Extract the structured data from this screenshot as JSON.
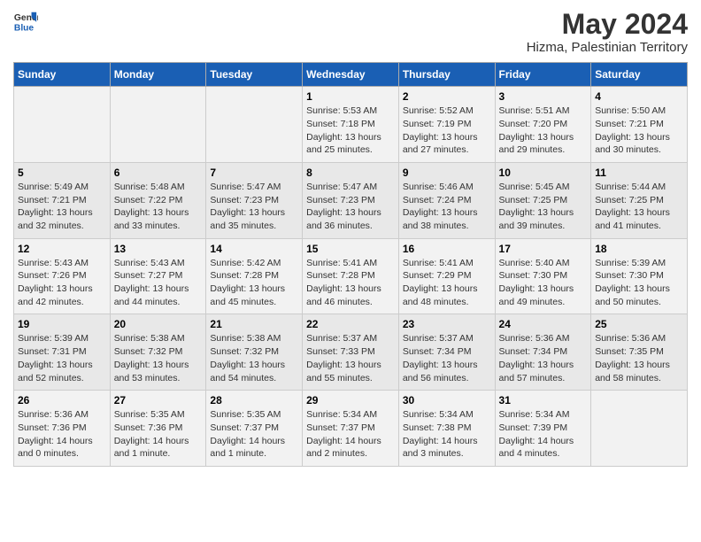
{
  "logo": {
    "line1": "General",
    "line2": "Blue"
  },
  "title": "May 2024",
  "subtitle": "Hizma, Palestinian Territory",
  "days_of_week": [
    "Sunday",
    "Monday",
    "Tuesday",
    "Wednesday",
    "Thursday",
    "Friday",
    "Saturday"
  ],
  "weeks": [
    [
      {
        "day": "",
        "info": ""
      },
      {
        "day": "",
        "info": ""
      },
      {
        "day": "",
        "info": ""
      },
      {
        "day": "1",
        "info": "Sunrise: 5:53 AM\nSunset: 7:18 PM\nDaylight: 13 hours\nand 25 minutes."
      },
      {
        "day": "2",
        "info": "Sunrise: 5:52 AM\nSunset: 7:19 PM\nDaylight: 13 hours\nand 27 minutes."
      },
      {
        "day": "3",
        "info": "Sunrise: 5:51 AM\nSunset: 7:20 PM\nDaylight: 13 hours\nand 29 minutes."
      },
      {
        "day": "4",
        "info": "Sunrise: 5:50 AM\nSunset: 7:21 PM\nDaylight: 13 hours\nand 30 minutes."
      }
    ],
    [
      {
        "day": "5",
        "info": "Sunrise: 5:49 AM\nSunset: 7:21 PM\nDaylight: 13 hours\nand 32 minutes."
      },
      {
        "day": "6",
        "info": "Sunrise: 5:48 AM\nSunset: 7:22 PM\nDaylight: 13 hours\nand 33 minutes."
      },
      {
        "day": "7",
        "info": "Sunrise: 5:47 AM\nSunset: 7:23 PM\nDaylight: 13 hours\nand 35 minutes."
      },
      {
        "day": "8",
        "info": "Sunrise: 5:47 AM\nSunset: 7:23 PM\nDaylight: 13 hours\nand 36 minutes."
      },
      {
        "day": "9",
        "info": "Sunrise: 5:46 AM\nSunset: 7:24 PM\nDaylight: 13 hours\nand 38 minutes."
      },
      {
        "day": "10",
        "info": "Sunrise: 5:45 AM\nSunset: 7:25 PM\nDaylight: 13 hours\nand 39 minutes."
      },
      {
        "day": "11",
        "info": "Sunrise: 5:44 AM\nSunset: 7:25 PM\nDaylight: 13 hours\nand 41 minutes."
      }
    ],
    [
      {
        "day": "12",
        "info": "Sunrise: 5:43 AM\nSunset: 7:26 PM\nDaylight: 13 hours\nand 42 minutes."
      },
      {
        "day": "13",
        "info": "Sunrise: 5:43 AM\nSunset: 7:27 PM\nDaylight: 13 hours\nand 44 minutes."
      },
      {
        "day": "14",
        "info": "Sunrise: 5:42 AM\nSunset: 7:28 PM\nDaylight: 13 hours\nand 45 minutes."
      },
      {
        "day": "15",
        "info": "Sunrise: 5:41 AM\nSunset: 7:28 PM\nDaylight: 13 hours\nand 46 minutes."
      },
      {
        "day": "16",
        "info": "Sunrise: 5:41 AM\nSunset: 7:29 PM\nDaylight: 13 hours\nand 48 minutes."
      },
      {
        "day": "17",
        "info": "Sunrise: 5:40 AM\nSunset: 7:30 PM\nDaylight: 13 hours\nand 49 minutes."
      },
      {
        "day": "18",
        "info": "Sunrise: 5:39 AM\nSunset: 7:30 PM\nDaylight: 13 hours\nand 50 minutes."
      }
    ],
    [
      {
        "day": "19",
        "info": "Sunrise: 5:39 AM\nSunset: 7:31 PM\nDaylight: 13 hours\nand 52 minutes."
      },
      {
        "day": "20",
        "info": "Sunrise: 5:38 AM\nSunset: 7:32 PM\nDaylight: 13 hours\nand 53 minutes."
      },
      {
        "day": "21",
        "info": "Sunrise: 5:38 AM\nSunset: 7:32 PM\nDaylight: 13 hours\nand 54 minutes."
      },
      {
        "day": "22",
        "info": "Sunrise: 5:37 AM\nSunset: 7:33 PM\nDaylight: 13 hours\nand 55 minutes."
      },
      {
        "day": "23",
        "info": "Sunrise: 5:37 AM\nSunset: 7:34 PM\nDaylight: 13 hours\nand 56 minutes."
      },
      {
        "day": "24",
        "info": "Sunrise: 5:36 AM\nSunset: 7:34 PM\nDaylight: 13 hours\nand 57 minutes."
      },
      {
        "day": "25",
        "info": "Sunrise: 5:36 AM\nSunset: 7:35 PM\nDaylight: 13 hours\nand 58 minutes."
      }
    ],
    [
      {
        "day": "26",
        "info": "Sunrise: 5:36 AM\nSunset: 7:36 PM\nDaylight: 14 hours\nand 0 minutes."
      },
      {
        "day": "27",
        "info": "Sunrise: 5:35 AM\nSunset: 7:36 PM\nDaylight: 14 hours\nand 1 minute."
      },
      {
        "day": "28",
        "info": "Sunrise: 5:35 AM\nSunset: 7:37 PM\nDaylight: 14 hours\nand 1 minute."
      },
      {
        "day": "29",
        "info": "Sunrise: 5:34 AM\nSunset: 7:37 PM\nDaylight: 14 hours\nand 2 minutes."
      },
      {
        "day": "30",
        "info": "Sunrise: 5:34 AM\nSunset: 7:38 PM\nDaylight: 14 hours\nand 3 minutes."
      },
      {
        "day": "31",
        "info": "Sunrise: 5:34 AM\nSunset: 7:39 PM\nDaylight: 14 hours\nand 4 minutes."
      },
      {
        "day": "",
        "info": ""
      }
    ]
  ]
}
